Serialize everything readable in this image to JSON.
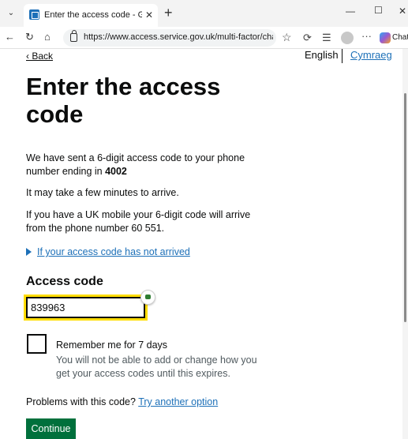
{
  "browser": {
    "tab_title": "Enter the access code - Governme",
    "url": "https://www.access.service.gov.uk/multi-factor/challenge/ay...",
    "chat_label": "Chat"
  },
  "nav": {
    "back": "Back",
    "lang_english": "English",
    "lang_welsh": "Cymraeg"
  },
  "main": {
    "heading": "Enter the access code",
    "sent_text": "We have sent a 6-digit access code to your phone number ending in ",
    "phone_ending": "4002",
    "wait_text": "It may take a few minutes to arrive.",
    "uk_mobile_text": "If you have a UK mobile your 6-digit code will arrive from the phone number 60 551.",
    "details_summary": "If your access code has not arrived",
    "access_code_label": "Access code",
    "access_code_value": "839963",
    "remember_label": "Remember me for 7 days",
    "remember_hint": "You will not be able to add or change how you get your access codes until this expires.",
    "problems_text": "Problems with this code? ",
    "problems_link": "Try another option",
    "continue_label": "Continue"
  },
  "colors": {
    "link": "#1d70b8",
    "focus": "#ffdd00",
    "button": "#00703c",
    "text": "#0b0c0c",
    "hint": "#505a5f"
  }
}
